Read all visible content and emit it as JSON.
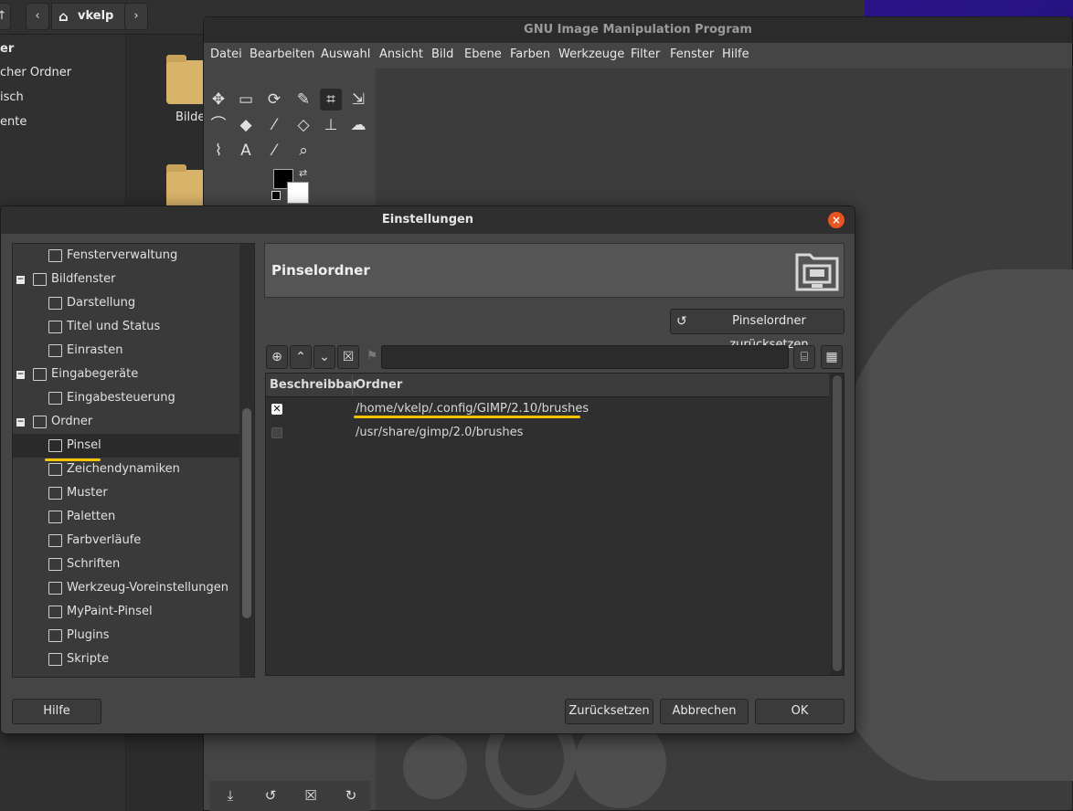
{
  "files": {
    "path_label": "vkelp",
    "sidebar": [
      {
        "label": "er",
        "bold": true
      },
      {
        "label": "cher Ordner",
        "bold": false
      },
      {
        "label": "isch",
        "bold": false
      },
      {
        "label": "ente",
        "bold": false
      }
    ],
    "folder_label": "Bilde"
  },
  "gimp": {
    "title": "GNU Image Manipulation Program",
    "menu": [
      "Datei",
      "Bearbeiten",
      "Auswahl",
      "Ansicht",
      "Bild",
      "Ebene",
      "Farben",
      "Werkzeuge",
      "Filter",
      "Fenster",
      "Hilfe"
    ],
    "tools": [
      [
        "move-tool-icon",
        "rect-select-tool-icon",
        "free-select-tool-icon",
        "fuzzy-select-tool-icon",
        "crop-tool-icon",
        "transform-tool-icon"
      ],
      [
        "warp-tool-icon",
        "bucket-fill-tool-icon",
        "paintbrush-tool-icon",
        "eraser-tool-icon",
        "clone-tool-icon",
        "smudge-tool-icon"
      ],
      [
        "paths-tool-icon",
        "text-tool-icon",
        "color-picker-tool-icon",
        "zoom-tool-icon"
      ]
    ],
    "tool_glyphs": [
      [
        "✥",
        "▭",
        "⟳",
        "✎",
        "⌗",
        "⇲"
      ],
      [
        "⌒",
        "◆",
        "⁄",
        "◇",
        "⊥",
        "☁"
      ],
      [
        "⌇",
        "A",
        "⁄",
        "⌕"
      ]
    ],
    "dock_icons": [
      "⤓",
      "↺",
      "☒",
      "↻"
    ]
  },
  "dialog": {
    "title": "Einstellungen",
    "close_glyph": "×",
    "tree": [
      {
        "label": "Fensterverwaltung",
        "level": 1,
        "icon": "window-management-icon",
        "expander": null,
        "selected": false
      },
      {
        "label": "Bildfenster",
        "level": 0,
        "icon": "image-window-icon",
        "expander": "−",
        "selected": false
      },
      {
        "label": "Darstellung",
        "level": 1,
        "icon": "appearance-icon",
        "expander": null,
        "selected": false
      },
      {
        "label": "Titel und Status",
        "level": 1,
        "icon": "title-status-icon",
        "expander": null,
        "selected": false
      },
      {
        "label": "Einrasten",
        "level": 1,
        "icon": "snapping-icon",
        "expander": null,
        "selected": false
      },
      {
        "label": "Eingabegeräte",
        "level": 0,
        "icon": "input-devices-icon",
        "expander": "−",
        "selected": false
      },
      {
        "label": "Eingabesteuerung",
        "level": 1,
        "icon": "input-controllers-icon",
        "expander": null,
        "selected": false
      },
      {
        "label": "Ordner",
        "level": 0,
        "icon": "folders-icon",
        "expander": "−",
        "selected": false
      },
      {
        "label": "Pinsel",
        "level": 1,
        "icon": "brushes-icon",
        "expander": null,
        "selected": true
      },
      {
        "label": "Zeichendynamiken",
        "level": 1,
        "icon": "dynamics-icon",
        "expander": null,
        "selected": false
      },
      {
        "label": "Muster",
        "level": 1,
        "icon": "patterns-icon",
        "expander": null,
        "selected": false
      },
      {
        "label": "Paletten",
        "level": 1,
        "icon": "palettes-icon",
        "expander": null,
        "selected": false
      },
      {
        "label": "Farbverläufe",
        "level": 1,
        "icon": "gradients-icon",
        "expander": null,
        "selected": false
      },
      {
        "label": "Schriften",
        "level": 1,
        "icon": "fonts-icon",
        "expander": null,
        "selected": false
      },
      {
        "label": "Werkzeug-Voreinstellungen",
        "level": 1,
        "icon": "tool-presets-icon",
        "expander": null,
        "selected": false
      },
      {
        "label": "MyPaint-Pinsel",
        "level": 1,
        "icon": "mypaint-brushes-icon",
        "expander": null,
        "selected": false
      },
      {
        "label": "Plugins",
        "level": 1,
        "icon": "plugins-icon",
        "expander": null,
        "selected": false
      },
      {
        "label": "Skripte",
        "level": 1,
        "icon": "scripts-icon",
        "expander": null,
        "selected": false
      }
    ],
    "page_title": "Pinselordner",
    "reset_folder_button": "Pinselordner zurücksetzen",
    "path_input_value": "",
    "list": {
      "col_writable": "Beschreibbar",
      "col_folder": "Ordner",
      "rows": [
        {
          "writable": true,
          "path": "/home/vkelp/.config/GIMP/2.10/brushes"
        },
        {
          "writable": false,
          "path": "/usr/share/gimp/2.0/brushes"
        }
      ]
    },
    "buttons": {
      "help": "Hilfe",
      "reset": "Zurücksetzen",
      "cancel": "Abbrechen",
      "ok": "OK"
    },
    "highlight_color": "#f5c400",
    "close_color": "#e95420"
  }
}
